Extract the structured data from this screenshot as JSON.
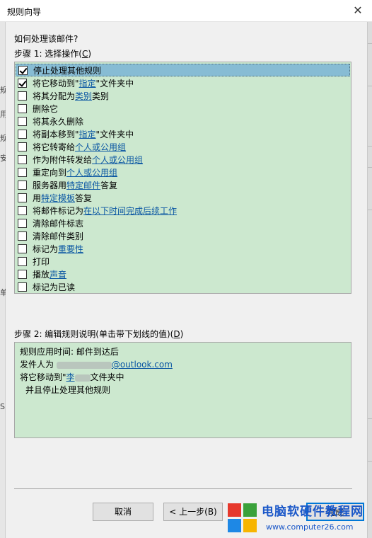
{
  "window": {
    "title": "规则向导",
    "close_glyph": "✕"
  },
  "left_fragments": [
    "规",
    "用",
    "规",
    "安",
    "单",
    "S"
  ],
  "prompt": "如何处理该邮件?",
  "step1": {
    "label": "步骤 1: 选择操作(",
    "accel": "C",
    "tail": ")"
  },
  "actions": [
    {
      "checked": true,
      "selected": true,
      "text": "停止处理其他规则"
    },
    {
      "checked": true,
      "text": "将它移动到\"",
      "link": "指定",
      "after": "\"文件夹中"
    },
    {
      "checked": false,
      "text": "将其分配为 ",
      "link": "类别",
      "after": " 类别"
    },
    {
      "checked": false,
      "text": "删除它"
    },
    {
      "checked": false,
      "text": "将其永久删除"
    },
    {
      "checked": false,
      "text": "将副本移到\"",
      "link": "指定",
      "after": "\"文件夹中"
    },
    {
      "checked": false,
      "text": "将它转寄给 ",
      "link": "个人或公用组"
    },
    {
      "checked": false,
      "text": "作为附件转发给 ",
      "link": "个人或公用组"
    },
    {
      "checked": false,
      "text": "重定向到 ",
      "link": "个人或公用组"
    },
    {
      "checked": false,
      "text": "服务器用 ",
      "link": "特定邮件",
      "after": " 答复"
    },
    {
      "checked": false,
      "text": "用 ",
      "link": "特定模板",
      "after": " 答复"
    },
    {
      "checked": false,
      "text": "将邮件标记为 ",
      "link": "在以下时间完成后续工作"
    },
    {
      "checked": false,
      "text": "清除邮件标志"
    },
    {
      "checked": false,
      "text": "清除邮件类别"
    },
    {
      "checked": false,
      "text": "标记为 ",
      "link": "重要性"
    },
    {
      "checked": false,
      "text": "打印"
    },
    {
      "checked": false,
      "text": "播放 ",
      "link": "声音"
    },
    {
      "checked": false,
      "text": "标记为已读"
    }
  ],
  "step2": {
    "label": "步骤 2: 编辑规则说明(单击带下划线的值)(",
    "accel": "D",
    "tail": ")"
  },
  "description": {
    "line1": "规则应用时间: 邮件到达后",
    "line2_prefix": "发件人为 ",
    "line2_link": "@outlook.com",
    "line3_prefix": "将它移动到\"",
    "line3_link": "李",
    "line3_suffix": "文件夹中",
    "line4": "并且停止处理其他规则"
  },
  "buttons": {
    "cancel": "取消",
    "back": "< 上一步(B)",
    "finish": "完成"
  },
  "watermark": {
    "title": "电脑软硬件教程网",
    "url": "www.computer26.com"
  },
  "colors": {
    "list_bg": "#cce8cf",
    "selected_bg": "#87bcd4",
    "link": "#0b57a3",
    "watermark": "#1a57c8"
  }
}
